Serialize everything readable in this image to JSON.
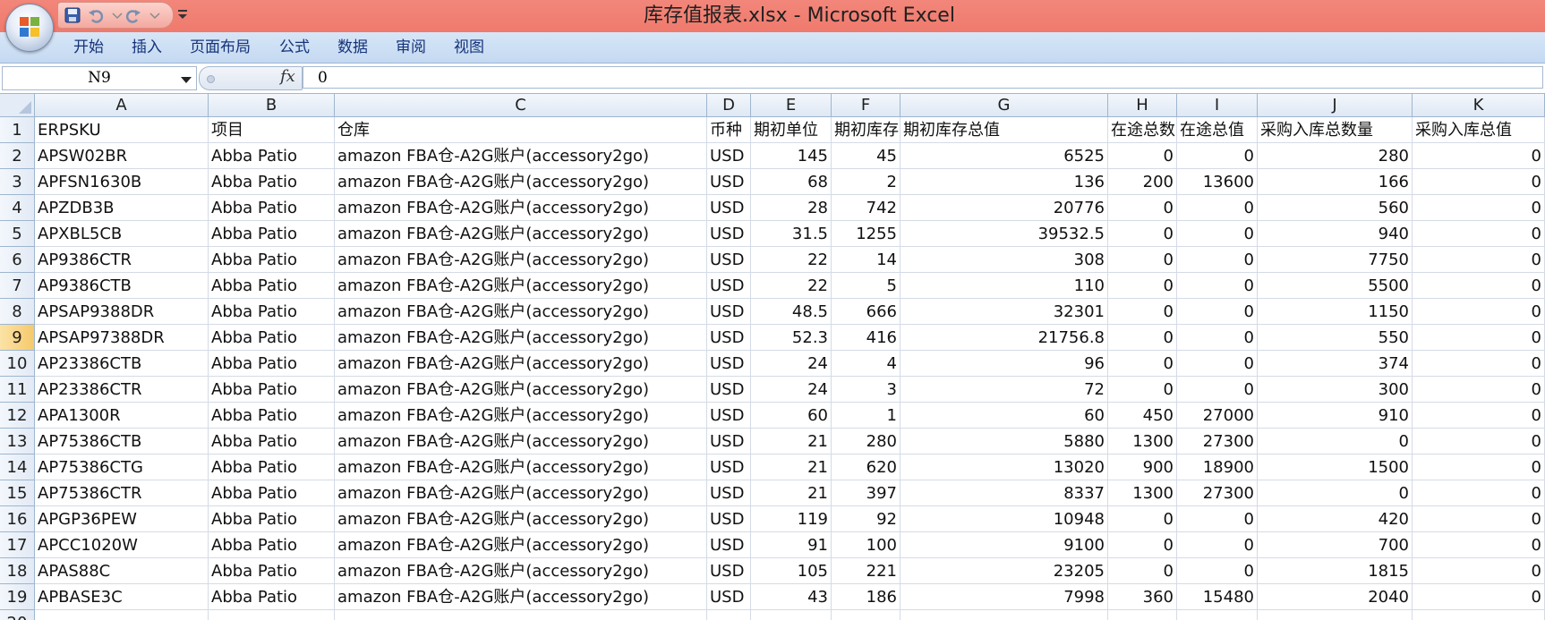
{
  "window": {
    "title": "库存值报表.xlsx - Microsoft Excel"
  },
  "ribbon": {
    "tabs": [
      "开始",
      "插入",
      "页面布局",
      "公式",
      "数据",
      "审阅",
      "视图"
    ]
  },
  "formula_bar": {
    "name_box": "N9",
    "fx_label": "fx",
    "value": "0"
  },
  "sheet": {
    "columns": [
      "A",
      "B",
      "C",
      "D",
      "E",
      "F",
      "G",
      "H",
      "I",
      "J",
      "K"
    ],
    "selected_row": 9,
    "header": [
      "ERPSKU",
      "项目",
      "仓库",
      "币种",
      "期初单位",
      "期初库存",
      "期初库存总值",
      "在途总数",
      "在途总值",
      "采购入库总数量",
      "采购入库总值"
    ],
    "rows": [
      [
        "APSW02BR",
        "Abba Patio",
        "amazon FBA仓-A2G账户(accessory2go)",
        "USD",
        "145",
        "45",
        "6525",
        "0",
        "0",
        "280",
        "0"
      ],
      [
        "APFSN1630B",
        "Abba Patio",
        "amazon FBA仓-A2G账户(accessory2go)",
        "USD",
        "68",
        "2",
        "136",
        "200",
        "13600",
        "166",
        "0"
      ],
      [
        "APZDB3B",
        "Abba Patio",
        "amazon FBA仓-A2G账户(accessory2go)",
        "USD",
        "28",
        "742",
        "20776",
        "0",
        "0",
        "560",
        "0"
      ],
      [
        "APXBL5CB",
        "Abba Patio",
        "amazon FBA仓-A2G账户(accessory2go)",
        "USD",
        "31.5",
        "1255",
        "39532.5",
        "0",
        "0",
        "940",
        "0"
      ],
      [
        "AP9386CTR",
        "Abba Patio",
        "amazon FBA仓-A2G账户(accessory2go)",
        "USD",
        "22",
        "14",
        "308",
        "0",
        "0",
        "7750",
        "0"
      ],
      [
        "AP9386CTB",
        "Abba Patio",
        "amazon FBA仓-A2G账户(accessory2go)",
        "USD",
        "22",
        "5",
        "110",
        "0",
        "0",
        "5500",
        "0"
      ],
      [
        "APSAP9388DR",
        "Abba Patio",
        "amazon FBA仓-A2G账户(accessory2go)",
        "USD",
        "48.5",
        "666",
        "32301",
        "0",
        "0",
        "1150",
        "0"
      ],
      [
        "APSAP97388DR",
        "Abba Patio",
        "amazon FBA仓-A2G账户(accessory2go)",
        "USD",
        "52.3",
        "416",
        "21756.8",
        "0",
        "0",
        "550",
        "0"
      ],
      [
        "AP23386CTB",
        "Abba Patio",
        "amazon FBA仓-A2G账户(accessory2go)",
        "USD",
        "24",
        "4",
        "96",
        "0",
        "0",
        "374",
        "0"
      ],
      [
        "AP23386CTR",
        "Abba Patio",
        "amazon FBA仓-A2G账户(accessory2go)",
        "USD",
        "24",
        "3",
        "72",
        "0",
        "0",
        "300",
        "0"
      ],
      [
        "APA1300R",
        "Abba Patio",
        "amazon FBA仓-A2G账户(accessory2go)",
        "USD",
        "60",
        "1",
        "60",
        "450",
        "27000",
        "910",
        "0"
      ],
      [
        "AP75386CTB",
        "Abba Patio",
        "amazon FBA仓-A2G账户(accessory2go)",
        "USD",
        "21",
        "280",
        "5880",
        "1300",
        "27300",
        "0",
        "0"
      ],
      [
        "AP75386CTG",
        "Abba Patio",
        "amazon FBA仓-A2G账户(accessory2go)",
        "USD",
        "21",
        "620",
        "13020",
        "900",
        "18900",
        "1500",
        "0"
      ],
      [
        "AP75386CTR",
        "Abba Patio",
        "amazon FBA仓-A2G账户(accessory2go)",
        "USD",
        "21",
        "397",
        "8337",
        "1300",
        "27300",
        "0",
        "0"
      ],
      [
        "APGP36PEW",
        "Abba Patio",
        "amazon FBA仓-A2G账户(accessory2go)",
        "USD",
        "119",
        "92",
        "10948",
        "0",
        "0",
        "420",
        "0"
      ],
      [
        "APCC1020W",
        "Abba Patio",
        "amazon FBA仓-A2G账户(accessory2go)",
        "USD",
        "91",
        "100",
        "9100",
        "0",
        "0",
        "700",
        "0"
      ],
      [
        "APAS88C",
        "Abba Patio",
        "amazon FBA仓-A2G账户(accessory2go)",
        "USD",
        "105",
        "221",
        "23205",
        "0",
        "0",
        "1815",
        "0"
      ],
      [
        "APBASE3C",
        "Abba Patio",
        "amazon FBA仓-A2G账户(accessory2go)",
        "USD",
        "43",
        "186",
        "7998",
        "360",
        "15480",
        "2040",
        "0"
      ]
    ]
  },
  "colors": {
    "titlebar": "#ef7a6d",
    "ribbon": "#c4d9f1",
    "grid_line": "#d4dbe6",
    "selected_row_header": "#f6c96c"
  }
}
